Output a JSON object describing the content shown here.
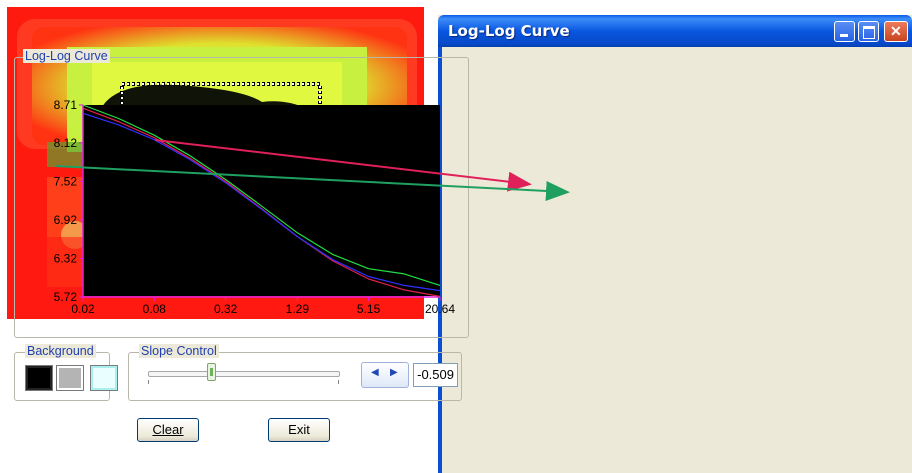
{
  "window": {
    "title": "Log-Log Curve",
    "controls": [
      "minimize-icon",
      "maximize-icon",
      "close-icon"
    ]
  },
  "groups": {
    "curve": "Log-Log Curve",
    "background": "Background",
    "slope": "Slope Control"
  },
  "background_options": [
    {
      "name": "black",
      "color": "#000000"
    },
    {
      "name": "gray",
      "color": "#b4b4b4"
    },
    {
      "name": "cyan",
      "color": "#e9ffff"
    }
  ],
  "slope": {
    "value": "-0.509",
    "slider_position": 0.33,
    "spinner_left": "◀",
    "spinner_right": "▶"
  },
  "buttons": {
    "clear": "Clear",
    "exit": "Exit"
  },
  "colors": {
    "title_bar": "#0a57e0",
    "plot_background": "#000000",
    "axis": "#e020e0",
    "arrow_red": "#e0205a",
    "arrow_green": "#20a060"
  },
  "chart_data": {
    "type": "line",
    "title": "",
    "xlabel": "",
    "ylabel": "",
    "x_scale": "log",
    "x_ticks": [
      "0.02",
      "0.08",
      "0.32",
      "1.29",
      "5.15",
      "20.64"
    ],
    "y_ticks": [
      "5.72",
      "6.32",
      "6.92",
      "7.52",
      "8.12",
      "8.71"
    ],
    "xlim": [
      0.02,
      20.64
    ],
    "ylim": [
      5.72,
      8.71
    ],
    "grid": false,
    "x": [
      0.02,
      0.04,
      0.08,
      0.16,
      0.32,
      0.64,
      1.29,
      2.58,
      5.15,
      10.3,
      20.64
    ],
    "series": [
      {
        "color": "#e0204a",
        "values": [
          8.66,
          8.45,
          8.2,
          7.88,
          7.52,
          7.1,
          6.66,
          6.28,
          6.0,
          5.83,
          5.73
        ]
      },
      {
        "color": "#20e040",
        "values": [
          8.71,
          8.5,
          8.24,
          7.92,
          7.55,
          7.14,
          6.72,
          6.38,
          6.16,
          6.08,
          5.9
        ]
      },
      {
        "color": "#3030ff",
        "values": [
          8.58,
          8.4,
          8.17,
          7.86,
          7.5,
          7.09,
          6.66,
          6.3,
          6.04,
          5.9,
          5.82
        ]
      }
    ]
  }
}
